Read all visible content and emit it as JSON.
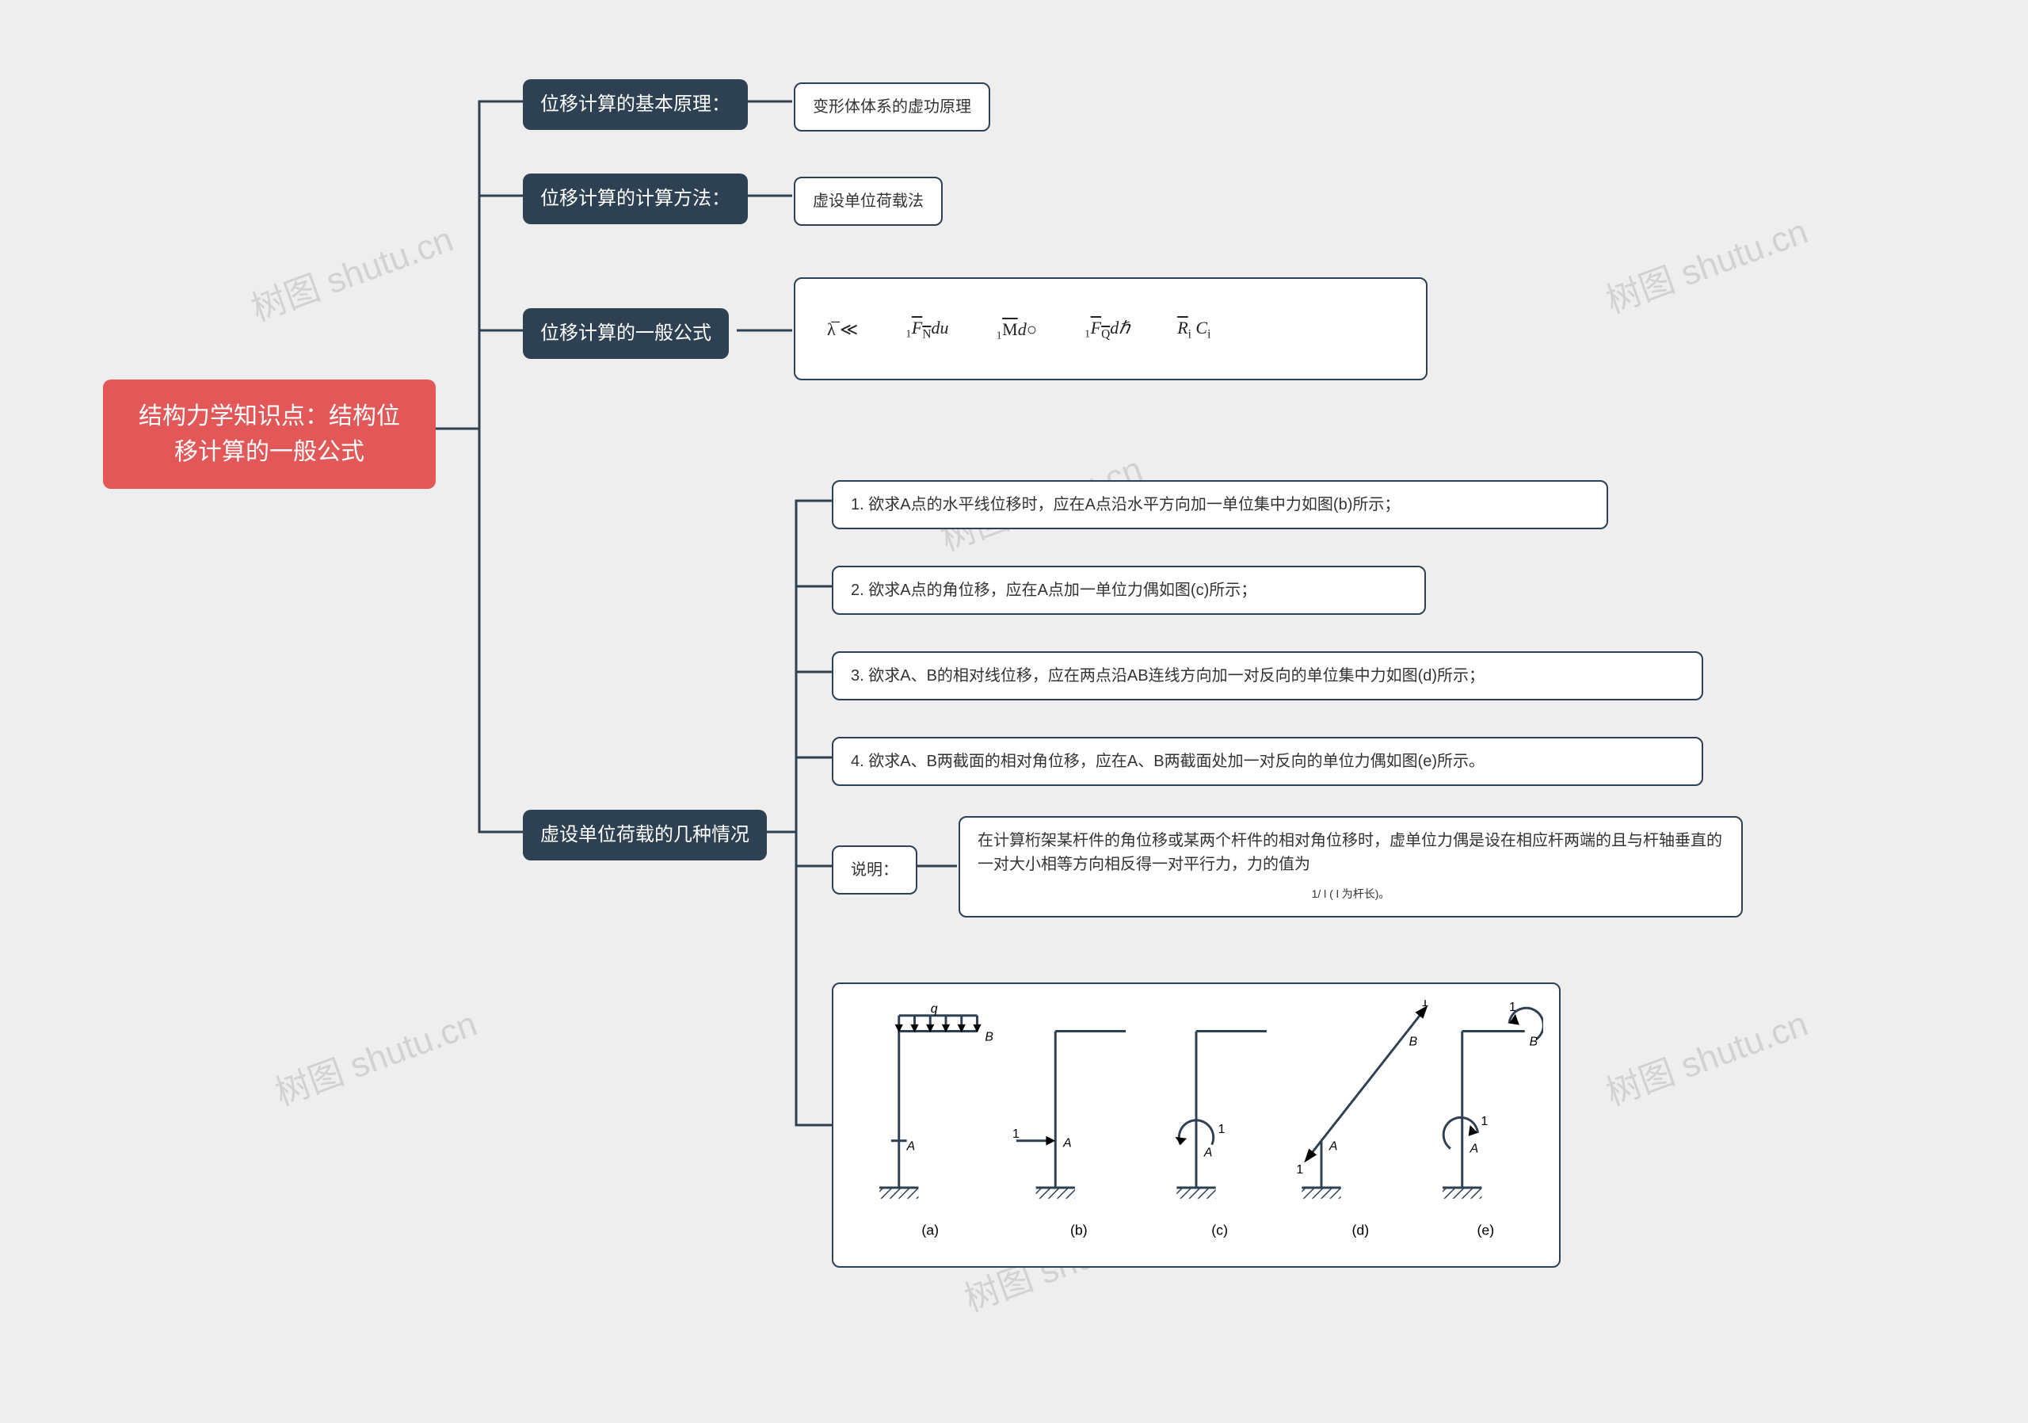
{
  "watermark": "树图 shutu.cn",
  "root": {
    "title_l1": "结构力学知识点：结构位",
    "title_l2": "移计算的一般公式"
  },
  "branches": {
    "b1": {
      "label": "位移计算的基本原理：",
      "leaf": "变形体体系的虚功原理"
    },
    "b2": {
      "label": "位移计算的计算方法：",
      "leaf": "虚设单位荷载法"
    },
    "b3": {
      "label": "位移计算的一般公式"
    },
    "b4": {
      "label": "虚设单位荷载的几种情况"
    }
  },
  "formula": {
    "parts": {
      "p1": "λ̅ ≪",
      "p2a": "₁",
      "p2b": "F",
      "p2c": "N",
      "p2d": "du",
      "p3a": "₁",
      "p3b": "M",
      "p3c": "d○",
      "p4a": "₁",
      "p4b": "F",
      "p4c": "Q",
      "p4d": "dℏ",
      "p5a": "R",
      "p5c": "i",
      "p5d": " C",
      "p5e": "i"
    }
  },
  "cases": {
    "c1": "1. 欲求A点的水平线位移时，应在A点沿水平方向加一单位集中力如图(b)所示；",
    "c2": "2. 欲求A点的角位移，应在A点加一单位力偶如图(c)所示；",
    "c3": "3. 欲求A、B的相对线位移，应在两点沿AB连线方向加一对反向的单位集中力如图(d)所示；",
    "c4": "4. 欲求A、B两截面的相对角位移，应在A、B两截面处加一对反向的单位力偶如图(e)所示。",
    "note_label": "说明：",
    "note_text": "在计算桁架某杆件的角位移或某两个杆件的相对角位移时，虚单位力偶是设在相应杆两端的且与杆轴垂直的一对大小相等方向相反得一对平行力，力的值为",
    "note_formula": "1/ l  ( l 为杆长)。",
    "labels": {
      "a": "(a)",
      "b": "(b)",
      "c": "(c)",
      "d": "(d)",
      "e": "(e)",
      "A": "A",
      "B": "B",
      "one": "1",
      "q": "q"
    }
  }
}
